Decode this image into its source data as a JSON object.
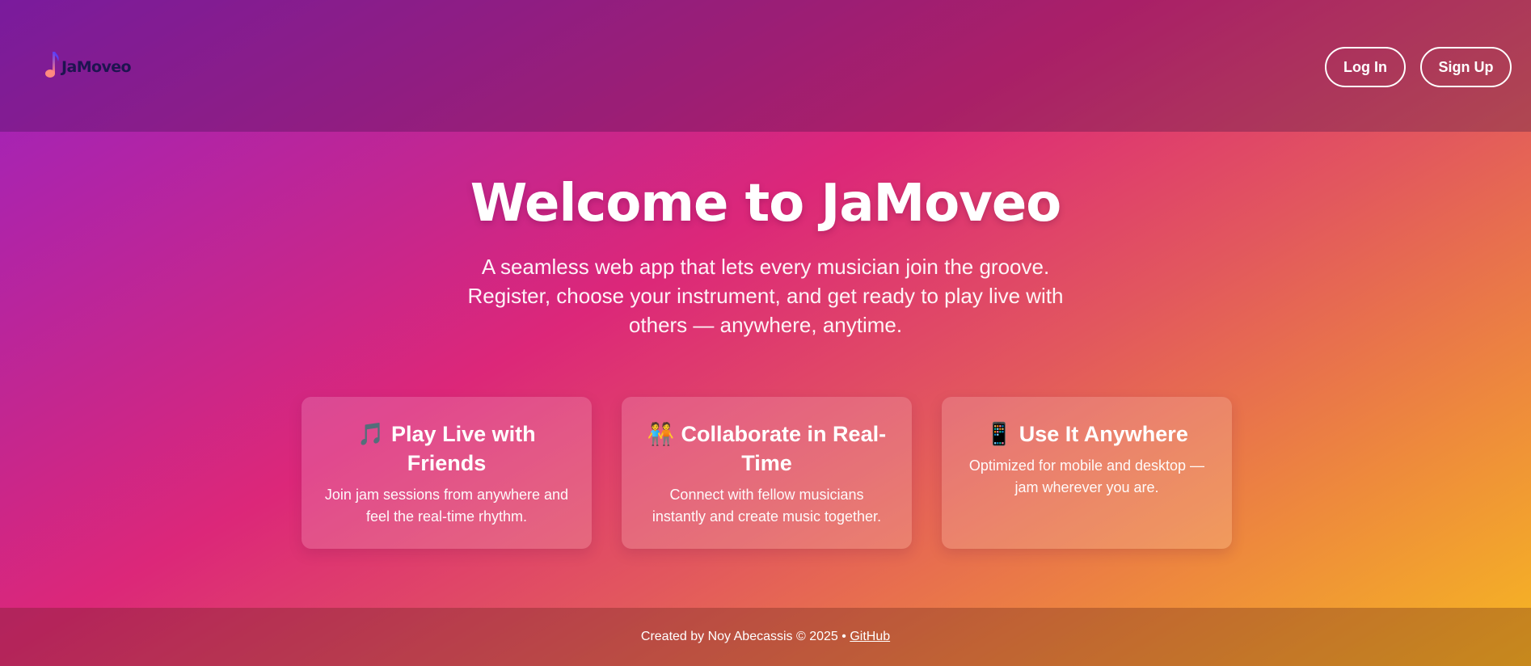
{
  "header": {
    "logo_text": "JaMoveo",
    "login_label": "Log In",
    "signup_label": "Sign Up"
  },
  "hero": {
    "title": "Welcome to JaMoveo",
    "subtitle": "A seamless web app that lets every musician join the groove. Register, choose your instrument, and get ready to play live with others — anywhere, anytime."
  },
  "features": [
    {
      "icon": "musical-notes-icon",
      "icon_glyph": "🎵",
      "title": "Play Live with Friends",
      "description": "Join jam sessions from anywhere and feel the real-time rhythm."
    },
    {
      "icon": "people-holding-hands-icon",
      "icon_glyph": "🧑‍🤝‍🧑",
      "title": "Collaborate in Real-Time",
      "description": "Connect with fellow musicians instantly and create music together."
    },
    {
      "icon": "mobile-phone-icon",
      "icon_glyph": "📱",
      "title": "Use It Anywhere",
      "description": "Optimized for mobile and desktop — jam wherever you are."
    }
  ],
  "footer": {
    "credit": "Created by Noy Abecassis © 2025 •",
    "github_label": "GitHub"
  },
  "colors": {
    "gradient": [
      "#9a22c2",
      "#dc2779",
      "#ee8a3c",
      "#f6b821"
    ],
    "logo_text": "#1e1450"
  }
}
